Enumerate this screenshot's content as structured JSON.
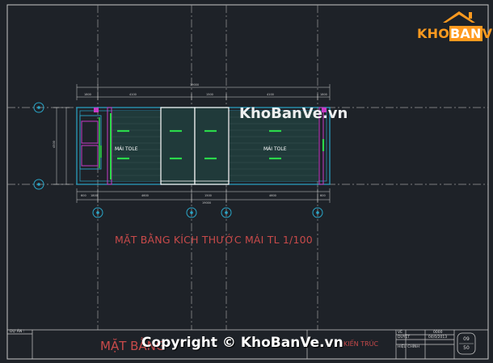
{
  "colors": {
    "background": "#1e2228",
    "frame": "#c8c8c8",
    "grid_line": "#9a9a9a",
    "wall": "#2aa6c8",
    "roof_fill": "#203a3a",
    "gutter": "#c73cc7",
    "green_mark": "#2bd84a",
    "axis_marker": "#2aa6c8",
    "title_red": "#c84a4a",
    "logo_orange": "#ff9a1f"
  },
  "logo": {
    "text_part1": "KHO",
    "text_part2": "BAN",
    "text_part3": "VE",
    "icon": "house-roof-icon"
  },
  "watermark": {
    "text": "KhoBanVe.vn"
  },
  "drawing": {
    "roof_label_left": "MÁI TOLE",
    "roof_label_right": "MÁI TOLE",
    "subtitle": "MẶT BẰNG KÍCH THƯỚC MÁI  TL 1/100",
    "axis_markers": [
      "axis-1",
      "axis-2",
      "axis-3",
      "axis-4",
      "axis-A",
      "axis-B"
    ]
  },
  "title_block": {
    "project_label": "DỰ ÁN :",
    "drawing_title": "MẶT BẰNG",
    "category": "KIẾN TRÚC",
    "row1_label": "VẼ",
    "row2_label": "DUYỆT",
    "row3_label": "HIỆU CHỈNH",
    "row1_value": "0000",
    "row2_value": "04/0/2013",
    "sheet_number": "09",
    "sheet_total": "50"
  },
  "copyright": {
    "text": "Copyright © KhoBanVe.vn"
  }
}
